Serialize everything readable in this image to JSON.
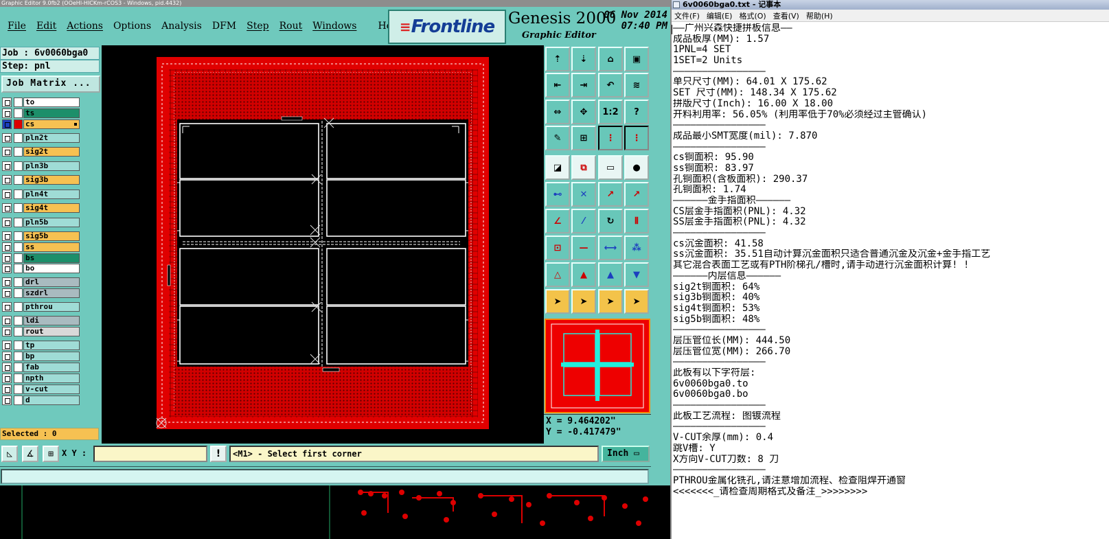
{
  "genesis": {
    "title_bar": "Graphic Editor 9.0fb2 (OOeHl-HICKm-rCOS3 - Windows, pid.4432)",
    "menu": [
      "File",
      "Edit",
      "Actions",
      "Options",
      "Analysis",
      "DFM",
      "Step",
      "Rout",
      "Windows"
    ],
    "help_label": "Help",
    "logo_text": "Frontline",
    "product_title": "Genesis 2000",
    "product_subtitle": "Graphic Editor",
    "date": "06 Nov 2014",
    "time": "07:40 PM",
    "job_label": "Job : 6v0060bga0",
    "step_label": "Step: pnl",
    "job_matrix_button": "Job Matrix ...",
    "layers": [
      {
        "name": "to",
        "color": "#ffffff"
      },
      {
        "name": "ts",
        "color": "#1d8f6a"
      },
      {
        "name": "cs",
        "color": "#f6c152",
        "active": true
      },
      {
        "name": "pln2t",
        "color": "#9fdcd6"
      },
      {
        "name": "sig2t",
        "color": "#f6c152"
      },
      {
        "name": "pln3b",
        "color": "#9fdcd6"
      },
      {
        "name": "sig3b",
        "color": "#f6c152"
      },
      {
        "name": "pln4t",
        "color": "#9fdcd6"
      },
      {
        "name": "sig4t",
        "color": "#f6c152"
      },
      {
        "name": "pln5b",
        "color": "#9fdcd6"
      },
      {
        "name": "sig5b",
        "color": "#f6c152"
      },
      {
        "name": "ss",
        "color": "#f6c152"
      },
      {
        "name": "bs",
        "color": "#1d8f6a"
      },
      {
        "name": "bo",
        "color": "#ffffff"
      },
      {
        "name": "drl",
        "color": "#a9bbc0"
      },
      {
        "name": "szdrl",
        "color": "#a9bbc0"
      },
      {
        "name": "pthrou",
        "color": "#9fdcd6"
      },
      {
        "name": "ldi",
        "color": "#a9bbc0"
      },
      {
        "name": "rout",
        "color": "#d9d9d9"
      },
      {
        "name": "tp",
        "color": "#9fdcd6"
      },
      {
        "name": "bp",
        "color": "#9fdcd6"
      },
      {
        "name": "fab",
        "color": "#9fdcd6"
      },
      {
        "name": "npth",
        "color": "#9fdcd6"
      },
      {
        "name": "v-cut",
        "color": "#9fdcd6"
      },
      {
        "name": "d",
        "color": "#9fdcd6"
      }
    ],
    "selected_label": "Selected : 0",
    "coord_x": "X = 9.464202\"",
    "coord_y": "Y = -0.417479\"",
    "xy_label": "X Y :",
    "xy_value": "",
    "prompt": "<M1> - Select first corner",
    "units": "Inch",
    "tool_labels": {
      "ratio": "1:2",
      "help": "?"
    },
    "colors": {
      "panel": "#6fc9bd",
      "board": "#e00000",
      "accent_yellow": "#f6c152"
    }
  },
  "notepad": {
    "title": "6v0060bga0.txt - 记事本",
    "menu": [
      "文件(F)",
      "编辑(E)",
      "格式(O)",
      "查看(V)",
      "帮助(H)"
    ],
    "lines": [
      "——广州兴森快捷拼板信息——",
      "成品板厚(MM): 1.57",
      "1PNL=4 SET",
      "1SET=2 Units",
      "————————————————",
      "单只尺寸(MM): 64.01 X 175.62",
      "SET 尺寸(MM): 148.34 X 175.62",
      "拼版尺寸(Inch): 16.00 X 18.00",
      "开料利用率: 56.05% (利用率低于70%必须经过主管确认)",
      "————————————————",
      "成品最小SMT宽度(mil): 7.870",
      "————————————————",
      "cs铜面积: 95.90",
      "ss铜面积: 83.97",
      "孔铜面积(含板面积): 290.37",
      "孔铜面积: 1.74",
      "——————金手指面积——————",
      "CS层金手指面积(PNL): 4.32",
      "SS层金手指面积(PNL): 4.32",
      "————————————————",
      "cs沉金面积: 41.58",
      "ss沉金面积: 35.51自动计算沉金面积只适合普通沉金及沉金+金手指工艺",
      "其它混合表面工艺或有PTH阶梯孔/槽时,请手动进行沉金面积计算! !",
      "——————内层信息——————",
      "sig2t铜面积: 64%",
      "sig3b铜面积: 40%",
      "sig4t铜面积: 53%",
      "sig5b铜面积: 48%",
      "————————————————",
      "层压管位长(MM): 444.50",
      "层压管位宽(MM): 266.70",
      "————————————————",
      "此板有以下字符层:",
      "6v0060bga0.to",
      "6v0060bga0.bo",
      "————————————————",
      "此板工艺流程: 图镀流程",
      "————————————————",
      "V-CUT余厚(mm): 0.4",
      "跳V槽: Y",
      "X方向V-CUT刀数: 8 刀",
      "————————————————",
      "PTHROU金属化铣孔,请注意增加流程、检查阻焊开通窗",
      "<<<<<<<_请检查周期格式及备注_>>>>>>>>"
    ]
  }
}
